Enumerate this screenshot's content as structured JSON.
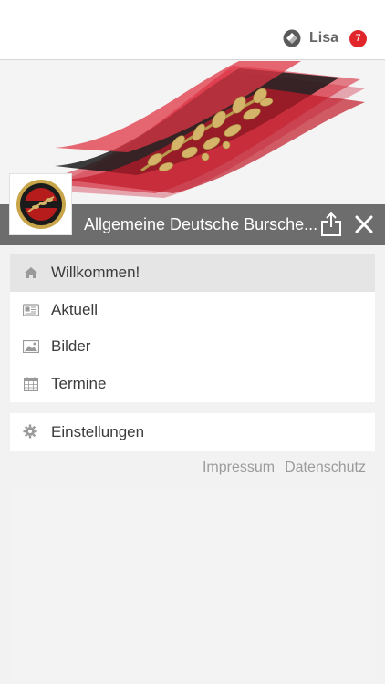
{
  "header": {
    "user_name": "Lisa",
    "notification_count": "7",
    "logo_icon": "lisa-logo-icon"
  },
  "banner": {
    "stripe_colors": [
      "#000000",
      "#c8102e"
    ],
    "emblem": "oak-branch"
  },
  "titlebar": {
    "title": "Allgemeine Deutsche Bursche...",
    "share_icon": "share-icon",
    "close_icon": "close-icon"
  },
  "menu": {
    "items": [
      {
        "label": "Willkommen!",
        "icon": "home-icon",
        "active": true
      },
      {
        "label": "Aktuell",
        "icon": "newspaper-icon",
        "active": false
      },
      {
        "label": "Bilder",
        "icon": "image-icon",
        "active": false
      },
      {
        "label": "Termine",
        "icon": "calendar-icon",
        "active": false
      }
    ]
  },
  "settings": {
    "label": "Einstellungen",
    "icon": "gear-icon"
  },
  "footer_links": {
    "impressum": "Impressum",
    "datenschutz": "Datenschutz"
  },
  "colors": {
    "accent_red": "#e0262b",
    "titlebar_bg": "#6d6d6d",
    "active_item_bg": "#e5e5e5"
  }
}
